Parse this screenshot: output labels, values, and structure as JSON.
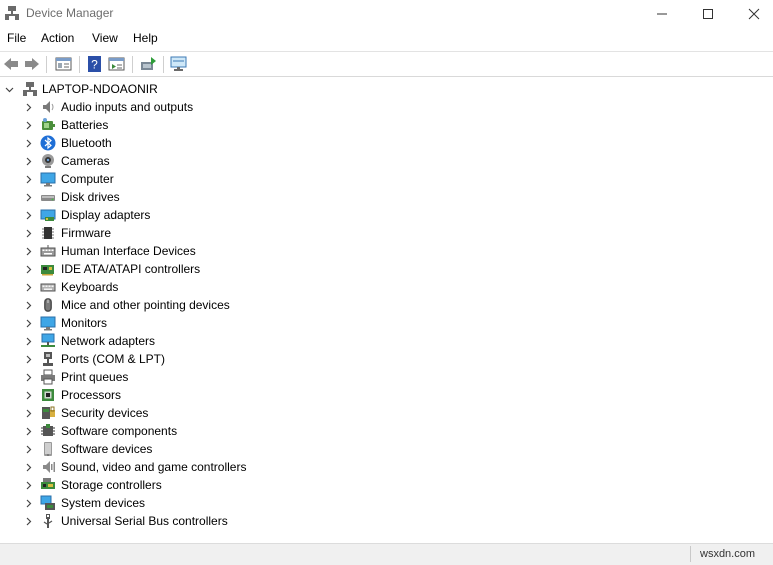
{
  "window": {
    "title": "Device Manager"
  },
  "menu": [
    "File",
    "Action",
    "View",
    "Help"
  ],
  "tree": {
    "root": "LAPTOP-NDOAONIR",
    "categories": [
      {
        "label": "Audio inputs and outputs",
        "icon": "speaker-icon"
      },
      {
        "label": "Batteries",
        "icon": "battery-icon"
      },
      {
        "label": "Bluetooth",
        "icon": "bluetooth-icon"
      },
      {
        "label": "Cameras",
        "icon": "camera-icon"
      },
      {
        "label": "Computer",
        "icon": "computer-icon"
      },
      {
        "label": "Disk drives",
        "icon": "disk-drive-icon"
      },
      {
        "label": "Display adapters",
        "icon": "display-adapter-icon"
      },
      {
        "label": "Firmware",
        "icon": "firmware-chip-icon"
      },
      {
        "label": "Human Interface Devices",
        "icon": "hid-keyboard-icon"
      },
      {
        "label": "IDE ATA/ATAPI controllers",
        "icon": "ide-controller-icon"
      },
      {
        "label": "Keyboards",
        "icon": "keyboard-icon"
      },
      {
        "label": "Mice and other pointing devices",
        "icon": "mouse-icon"
      },
      {
        "label": "Monitors",
        "icon": "monitor-icon"
      },
      {
        "label": "Network adapters",
        "icon": "network-adapter-icon"
      },
      {
        "label": "Ports (COM & LPT)",
        "icon": "port-icon"
      },
      {
        "label": "Print queues",
        "icon": "printer-icon"
      },
      {
        "label": "Processors",
        "icon": "processor-icon"
      },
      {
        "label": "Security devices",
        "icon": "security-device-icon"
      },
      {
        "label": "Software components",
        "icon": "software-component-icon"
      },
      {
        "label": "Software devices",
        "icon": "software-device-icon"
      },
      {
        "label": "Sound, video and game controllers",
        "icon": "sound-controller-icon"
      },
      {
        "label": "Storage controllers",
        "icon": "storage-controller-icon"
      },
      {
        "label": "System devices",
        "icon": "system-device-icon"
      },
      {
        "label": "Universal Serial Bus controllers",
        "icon": "usb-icon"
      }
    ]
  },
  "toolbar_icons": [
    "back-arrow-icon",
    "forward-arrow-icon",
    "properties-icon",
    "help-icon",
    "action-icon",
    "update-driver-icon",
    "scan-hardware-icon"
  ],
  "watermark": "wsxdn.com"
}
